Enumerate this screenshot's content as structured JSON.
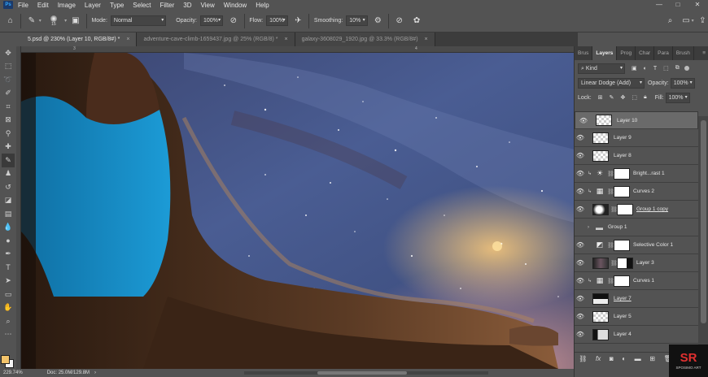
{
  "app": {
    "logo_text": "Ps"
  },
  "menu": [
    "File",
    "Edit",
    "Image",
    "Layer",
    "Type",
    "Select",
    "Filter",
    "3D",
    "View",
    "Window",
    "Help"
  ],
  "window_controls": {
    "minimize": "—",
    "maximize": "□",
    "close": "✕"
  },
  "options_bar": {
    "brush_size": "15",
    "mode_label": "Mode:",
    "mode_value": "Normal",
    "opacity_label": "Opacity:",
    "opacity_value": "100%",
    "flow_label": "Flow:",
    "flow_value": "100%",
    "smoothing_label": "Smoothing:",
    "smoothing_value": "10%"
  },
  "tabs": [
    {
      "label": "5.psd @ 230% (Layer 10, RGB/8#) *",
      "close": "×",
      "active": true
    },
    {
      "label": "adventure-cave-climb-1659437.jpg @ 25% (RGB/8) *",
      "close": "×",
      "active": false
    },
    {
      "label": "galaxy-3608029_1920.jpg @ 33.3% (RGB/8#)",
      "close": "×",
      "active": false
    }
  ],
  "ruler": {
    "top_mark_1": "3",
    "top_mark_2": "4"
  },
  "status": {
    "zoom": "229.74%",
    "doc": "Doc: 25.0M/129.8M"
  },
  "panel": {
    "tabs": [
      "Brus",
      "Layers",
      "Prog",
      "Char",
      "Para",
      "Brush"
    ],
    "filter_label": "Kind",
    "blend_mode": "Linear Dodge (Add)",
    "opacity_label": "Opacity:",
    "opacity_value": "100%",
    "lock_label": "Lock:",
    "fill_label": "Fill:",
    "fill_value": "100%"
  },
  "layers": [
    {
      "name": "Layer 10",
      "type": "pixel",
      "selected": true
    },
    {
      "name": "Layer 9",
      "type": "pixel"
    },
    {
      "name": "Layer 8",
      "type": "pixel"
    },
    {
      "name": "Bright...rast 1",
      "type": "brightness",
      "clipped": true
    },
    {
      "name": "Curves 2",
      "type": "curves",
      "clipped": true
    },
    {
      "name": "Group 1 copy",
      "type": "smart",
      "underline": true
    },
    {
      "name": "Group 1",
      "type": "group",
      "hidden": true
    },
    {
      "name": "Selective Color 1",
      "type": "selective"
    },
    {
      "name": "Layer 3",
      "type": "image"
    },
    {
      "name": "Curves 1",
      "type": "curves",
      "clipped": true
    },
    {
      "name": "Layer 7",
      "type": "pixel-dark",
      "underline": true
    },
    {
      "name": "Layer 5",
      "type": "pixel"
    },
    {
      "name": "Layer 4",
      "type": "pixel-dark2"
    }
  ],
  "watermark": {
    "mark": "SR",
    "text": "SPOSIMO ART"
  },
  "colors": {
    "ui_bg": "#535353",
    "accent": "#31a8ff",
    "foreground_swatch": "#f3c46b"
  }
}
